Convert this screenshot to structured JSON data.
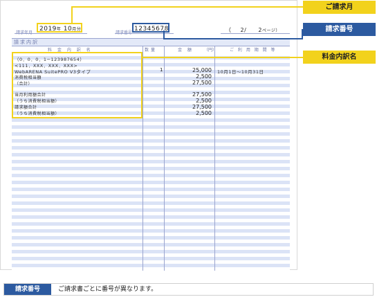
{
  "header": {
    "billing_month_label": "請求年月",
    "billing_year": "2019",
    "year_unit": "年",
    "billing_month": "10",
    "month_unit": "月分",
    "invoice_number_label": "請求番号",
    "invoice_number": "12345678",
    "page_open": "（",
    "page_current": "2/",
    "page_total": "2",
    "page_unit": "ページ）"
  },
  "section": {
    "title": "請求内訳"
  },
  "columns": {
    "item": "料 金 内 訳 名",
    "qty": "数量",
    "amount": "金 額",
    "amount_unit": "（円）",
    "period": "ご 利 用 期 間 等"
  },
  "lines": [
    "（0．0．0．1−123987654）",
    "<111．XXX．XXX．XXX>",
    "WebARENA SuitePRO V3タイプ",
    "消費税相当額",
    "（合計）",
    "当月利用額合計",
    "（うち消費税相当額）",
    "請求額合計",
    "（うち消費税相当額）"
  ],
  "quantity": "1",
  "amounts": [
    "25,000",
    "2,500",
    "27,500",
    "27,500",
    "2,500",
    "27,500",
    "2,500"
  ],
  "period": "10月1日〜10月31日",
  "callouts": {
    "billing_month": "ご請求月",
    "invoice_number": "請求番号",
    "item_name": "料金内訳名"
  },
  "note": {
    "tag": "請求番号",
    "text": "ご請求書ごとに番号が異なります。"
  },
  "colors": {
    "yellow": "#f2d21c",
    "blue": "#2c5aa0",
    "stripe": "#dbe3f6"
  }
}
